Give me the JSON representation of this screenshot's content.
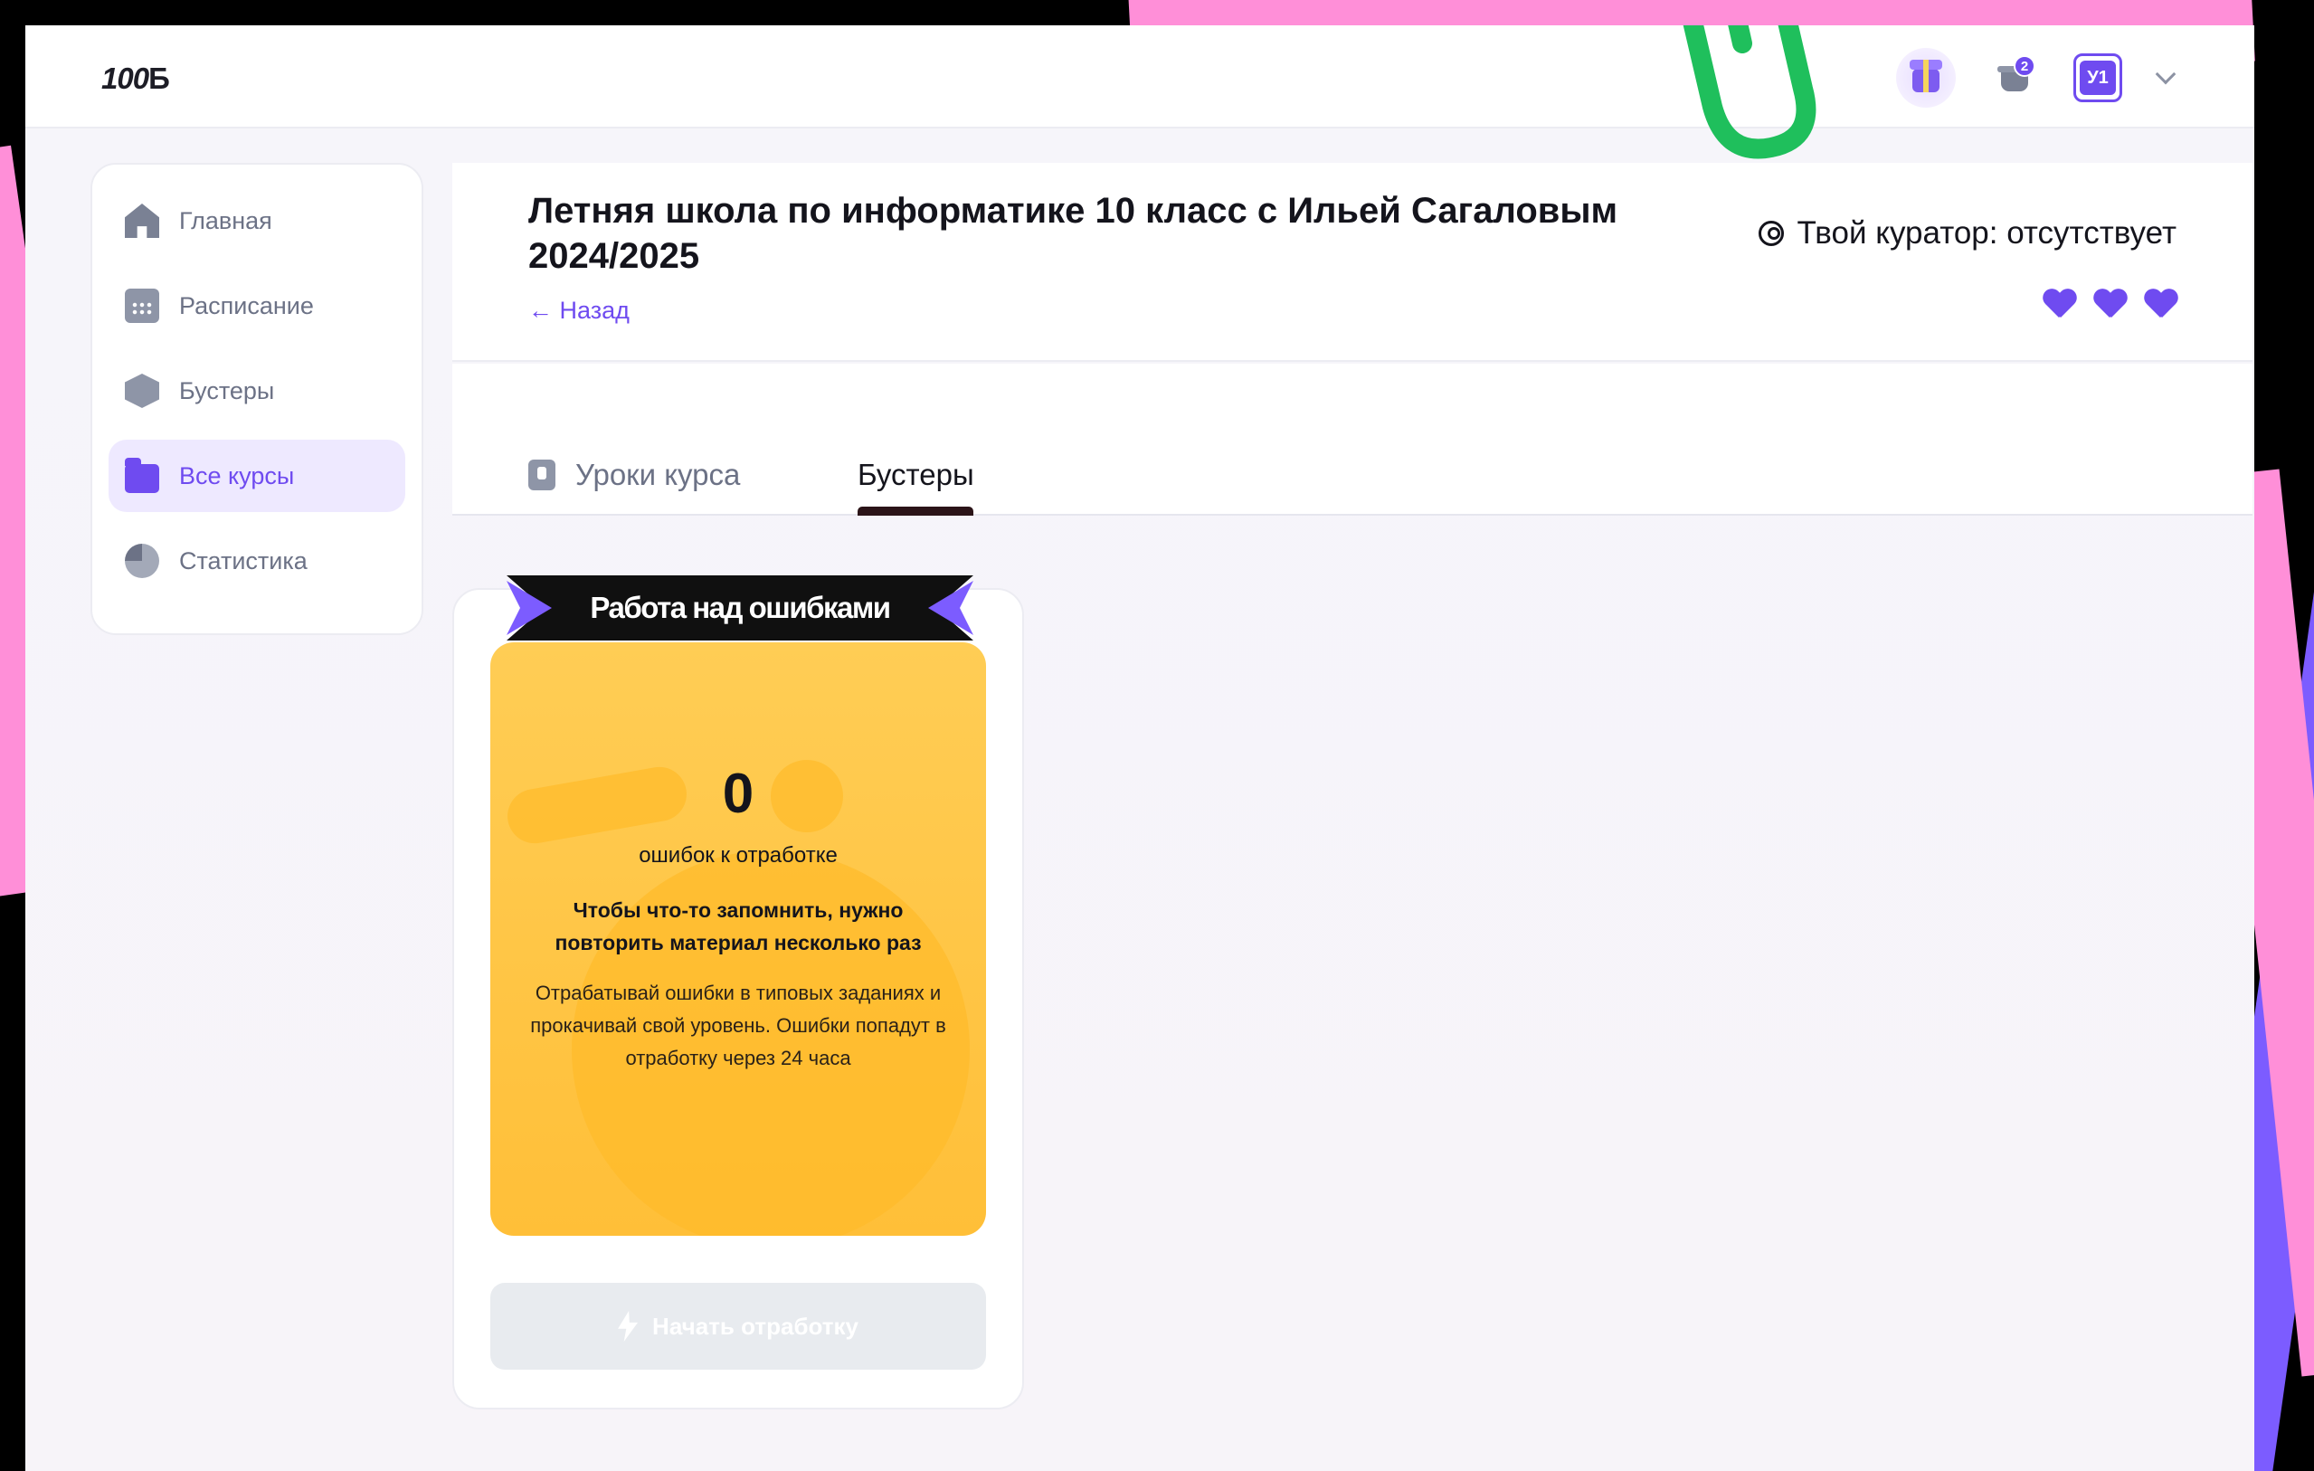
{
  "header": {
    "logo": "100",
    "logo_suffix": "Б",
    "cart_badge": "2",
    "avatar_initials": "У1"
  },
  "sidebar": {
    "items": [
      {
        "label": "Главная",
        "icon": "home-icon",
        "active": false
      },
      {
        "label": "Расписание",
        "icon": "calendar-icon",
        "active": false
      },
      {
        "label": "Бустеры",
        "icon": "cube-icon",
        "active": false
      },
      {
        "label": "Все курсы",
        "icon": "folder-icon",
        "active": true
      },
      {
        "label": "Статистика",
        "icon": "pie-chart-icon",
        "active": false
      }
    ]
  },
  "course": {
    "title": "Летняя школа по информатике 10 класс с Ильей Сагаловым 2024/2025",
    "back_label": "← Назад",
    "curator": "Твой куратор: отсутствует",
    "hearts": 3
  },
  "tabs": {
    "items": [
      {
        "label": "Уроки курса",
        "active": false
      },
      {
        "label": "Бустеры",
        "active": true
      }
    ]
  },
  "booster": {
    "ribbon": "Работа над ошибками",
    "count": "0",
    "count_label": "ошибок к отработке",
    "motto": "Чтобы что-то запомнить, нужно повторить материал несколько раз",
    "description": "Отрабатывай ошибки в типовых заданиях и прокачивай свой уровень. Ошибки попадут в отработку через 24 часа",
    "button_label": "Начать отработку",
    "button_disabled": true
  },
  "colors": {
    "accent": "#6f4bf0",
    "card_yellow": "#ffc646",
    "deco_pink": "#ff8fd8",
    "deco_green": "#1fbf5c"
  }
}
